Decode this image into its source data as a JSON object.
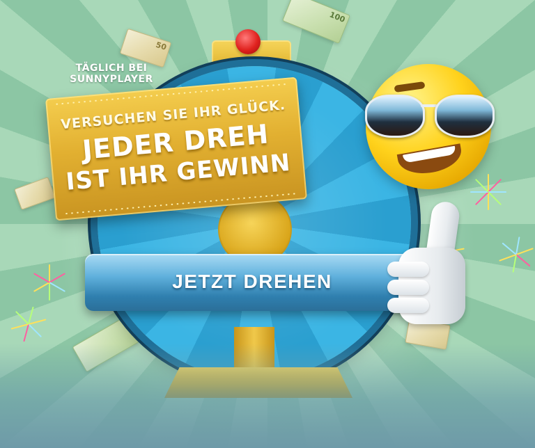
{
  "banner": {
    "daily_line1": "TÄGLICH BEI",
    "daily_line2": "SUNNYPLAYER",
    "sign_line1": "VERSUCHEN SIE IHR GLÜCK.",
    "sign_line2": "JEDER DREH",
    "sign_line3": "IST IHR GEWINN",
    "cta_label": "JETZT DREHEN"
  },
  "notes": {
    "denomination_top_left": "50",
    "denomination_top_right": "100"
  },
  "colors": {
    "gold": "#e2b031",
    "wheel_blue": "#2a9fd0",
    "cta_blue": "#2f7fae",
    "pointer_red": "#e0221e",
    "background_green": "#9ccfb0"
  },
  "icons": {
    "mascot": "sunglasses-smiley",
    "hand": "thumbs-up-glove",
    "wheel": "fortune-wheel",
    "money": "euro-banknote",
    "fireworks": "firework-burst"
  }
}
